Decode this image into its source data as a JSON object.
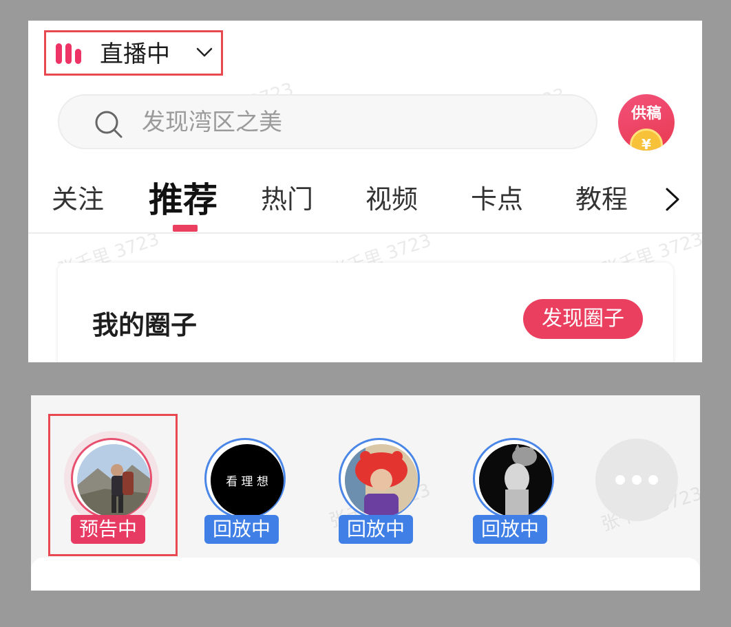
{
  "header": {
    "live_label": "直播中"
  },
  "search": {
    "placeholder": "发现湾区之美"
  },
  "contribute": {
    "label": "供稿",
    "coin_symbol": "¥"
  },
  "tabs": [
    {
      "label": "关注"
    },
    {
      "label": "推荐",
      "active": true
    },
    {
      "label": "热门"
    },
    {
      "label": "视频"
    },
    {
      "label": "卡点"
    },
    {
      "label": "教程"
    }
  ],
  "circle": {
    "title": "我的圈子",
    "discover_label": "发现圈子"
  },
  "stories": [
    {
      "badge": "预告中",
      "badge_color": "#e83b64",
      "avatar": "hiker-photo"
    },
    {
      "badge": "回放中",
      "badge_color": "#3f7fe6",
      "avatar": "text-logo",
      "avatar_text": "看 理 想"
    },
    {
      "badge": "回放中",
      "badge_color": "#3f7fe6",
      "avatar": "boy-crab-hat-photo"
    },
    {
      "badge": "回放中",
      "badge_color": "#3f7fe6",
      "avatar": "man-with-cat-photo"
    }
  ],
  "more": {
    "icon": "more-dots-icon"
  },
  "watermark": "张千里 3723",
  "colors": {
    "accent": "#ea3f5f",
    "replay_blue": "#3f7fe6",
    "highlight_frame": "#e8484f"
  }
}
